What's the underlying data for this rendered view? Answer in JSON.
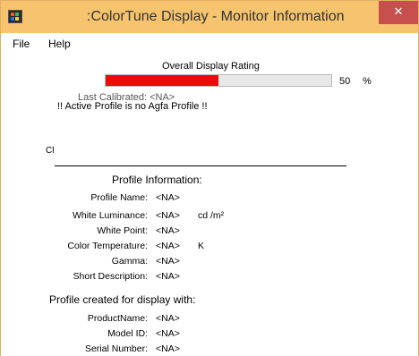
{
  "window": {
    "title": ":ColorTune Display -  Monitor Information",
    "close_glyph": "✕"
  },
  "menu": {
    "items": [
      "File",
      "Help"
    ]
  },
  "rating": {
    "label": "Overall Display Rating",
    "value": "50",
    "unit": "%",
    "percent": 50,
    "fill_color": "#ee0a0a"
  },
  "overlapped_text": "Last Calibrated: <NA>",
  "warning": "!! Active Profile is no Agfa Profile !!",
  "partial_label": "Cl",
  "profile_info": {
    "title": "Profile Information:",
    "rows": [
      {
        "label": "Profile Name:",
        "value": "<NA>",
        "unit": ""
      },
      {
        "label": "White Luminance:",
        "value": "<NA>",
        "unit": "cd /m²"
      },
      {
        "label": "White Point:",
        "value": "<NA>",
        "unit": ""
      },
      {
        "label": "Color Temperature:",
        "value": "<NA>",
        "unit": "K"
      },
      {
        "label": "Gamma:",
        "value": "<NA>",
        "unit": ""
      },
      {
        "label": "Short Description:",
        "value": "<NA>",
        "unit": ""
      }
    ]
  },
  "display_info": {
    "title": "Profile created for display with:",
    "rows": [
      {
        "label": "ProductName:",
        "value": "<NA>"
      },
      {
        "label": "Model ID:",
        "value": "<NA>"
      },
      {
        "label": "Serial Number:",
        "value": "<NA>"
      }
    ]
  }
}
